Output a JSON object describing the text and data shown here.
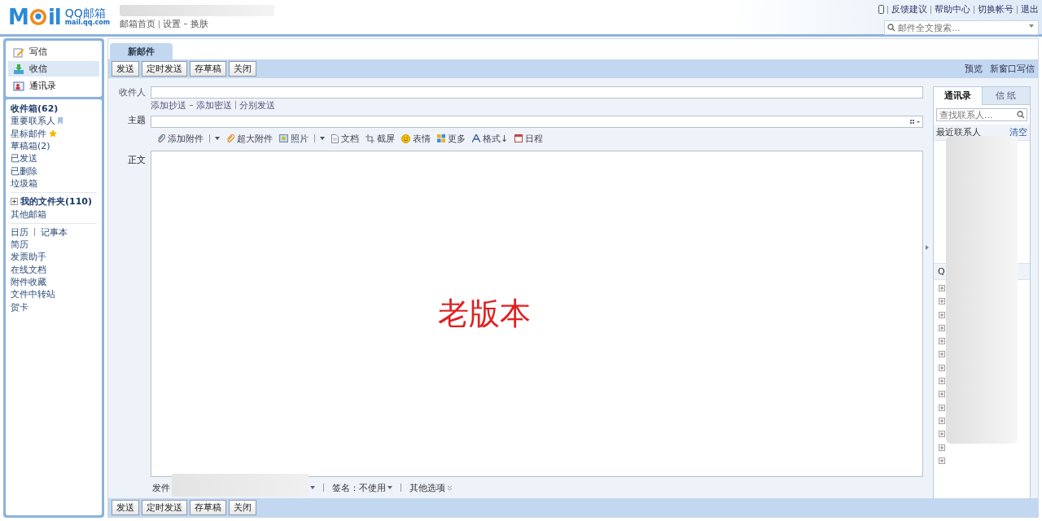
{
  "header": {
    "logo_letters": [
      "M",
      "il"
    ],
    "logo_text": "QQ邮箱",
    "logo_sub": "mail.qq.com",
    "links": [
      "邮箱首页",
      "设置",
      "换肤"
    ],
    "top_links": [
      "反馈建议",
      "帮助中心",
      "切换帐号",
      "退出"
    ],
    "search": {
      "placeholder": "邮件全文搜索..."
    }
  },
  "sidebar": {
    "actions": [
      {
        "label": "写信",
        "kind": "compose",
        "selected": false
      },
      {
        "label": "收信",
        "kind": "receive",
        "selected": true
      },
      {
        "label": "通讯录",
        "kind": "contacts",
        "selected": false
      }
    ],
    "folders": [
      {
        "label": "收件箱(62)",
        "bold": true,
        "kind": "plain"
      },
      {
        "label": "重要联系人",
        "bold": false,
        "kind": "flagged"
      },
      {
        "label": "星标邮件",
        "bold": false,
        "kind": "starred"
      },
      {
        "label": "草稿箱(2)",
        "bold": false,
        "kind": "plain"
      },
      {
        "label": "已发送",
        "bold": false,
        "kind": "plain"
      },
      {
        "label": "已删除",
        "bold": false,
        "kind": "plain"
      },
      {
        "label": "垃圾箱",
        "bold": false,
        "kind": "plain"
      }
    ],
    "my_folders": {
      "label": "我的文件夹(110)",
      "expanded": false
    },
    "other": [
      "其他邮箱"
    ],
    "tools_inline": [
      "日历",
      "记事本"
    ],
    "tools": [
      "简历",
      "发票助手",
      "在线文档",
      "附件收藏",
      "文件中转站",
      "贺卡"
    ]
  },
  "tabs": [
    {
      "label": "新邮件",
      "selected": true
    }
  ],
  "toolbar": {
    "buttons": [
      "发送",
      "定时发送",
      "存草稿",
      "关闭"
    ],
    "links": [
      "预览",
      "新窗口写信"
    ]
  },
  "form": {
    "to_label": "收件人",
    "cc_links": [
      "添加抄送",
      "添加密送",
      "分别发送"
    ],
    "subject_label": "主题",
    "tools": [
      {
        "label": "添加附件",
        "kind": "attach",
        "dropdown": true
      },
      {
        "label": "超大附件",
        "kind": "bigattach",
        "dropdown": false
      },
      {
        "label": "照片",
        "kind": "photo",
        "dropdown": true
      },
      {
        "label": "文档",
        "kind": "doc",
        "dropdown": false
      },
      {
        "label": "截屏",
        "kind": "screenshot",
        "dropdown": false
      },
      {
        "label": "表情",
        "kind": "emoji",
        "dropdown": false
      },
      {
        "label": "更多",
        "kind": "more",
        "dropdown": false
      },
      {
        "label": "格式↓",
        "kind": "format",
        "dropdown": false
      },
      {
        "label": "日程",
        "kind": "schedule",
        "dropdown": false
      }
    ],
    "body_label": "正文",
    "annotation": "老版本",
    "sender_label": "发件",
    "signature": "签名：不使用",
    "other_options": "其他选项"
  },
  "contacts": {
    "tabs": [
      {
        "label": "通讯录",
        "selected": true
      },
      {
        "label": "信 纸",
        "selected": false
      }
    ],
    "search": {
      "placeholder": "查找联系人..."
    },
    "recent": "最近联系人",
    "clear": "清空",
    "group_header": "Q",
    "groups": [
      {
        "expanded": false
      },
      {
        "expanded": false
      },
      {
        "expanded": false
      },
      {
        "expanded": false
      },
      {
        "expanded": false
      },
      {
        "expanded": false
      },
      {
        "expanded": false
      },
      {
        "expanded": false
      },
      {
        "expanded": false
      },
      {
        "expanded": false
      },
      {
        "expanded": false
      },
      {
        "expanded": false
      },
      {
        "expanded": false
      },
      {
        "expanded": false
      }
    ]
  },
  "bottom_toolbar": {
    "buttons": [
      "发送",
      "定时发送",
      "存草稿",
      "关闭"
    ]
  }
}
